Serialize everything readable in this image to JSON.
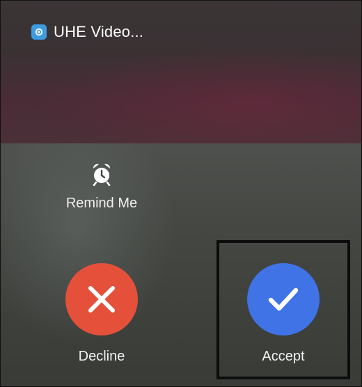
{
  "notification": {
    "app_name": "UHE Video...",
    "app_icon": "app-icon",
    "app_icon_color": "#3d9be0"
  },
  "actions": {
    "remind": {
      "label": "Remind Me",
      "icon": "alarm-clock-icon"
    },
    "decline": {
      "label": "Decline",
      "icon": "close-icon",
      "color": "#e5503b"
    },
    "accept": {
      "label": "Accept",
      "icon": "checkmark-icon",
      "color": "#3f73e6"
    }
  }
}
